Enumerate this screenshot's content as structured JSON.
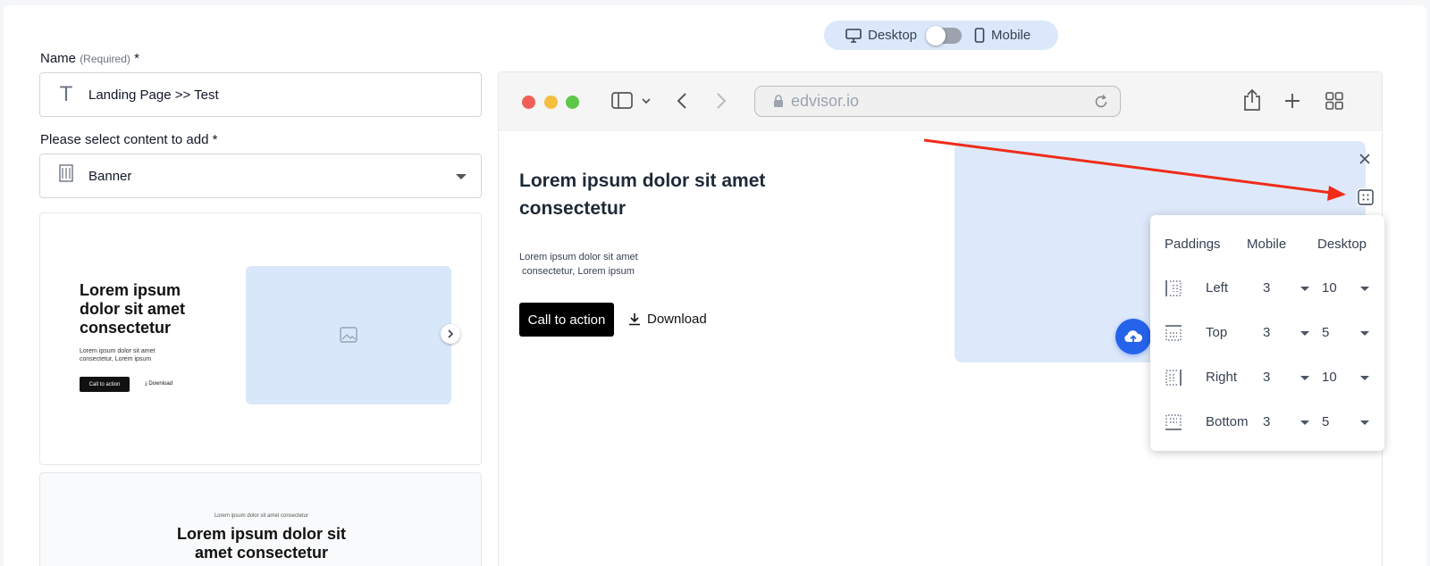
{
  "view_toggle": {
    "desktop_label": "Desktop",
    "mobile_label": "Mobile",
    "selected": "Desktop"
  },
  "form": {
    "name_label": "Name",
    "name_required_hint": "(Required)",
    "asterisk": "*",
    "name_value": "Landing Page >> Test",
    "content_label": "Please select content to add",
    "content_value": "Banner"
  },
  "templates": [
    {
      "title": "Lorem ipsum dolor sit amet consectetur",
      "text": "Lorem ipsum dolor sit amet consectetur, Lorem ipsum",
      "cta": "Call to action",
      "download": "Download"
    },
    {
      "eyebrow": "Lorem ipsum dolor sit amet consectetur",
      "title": "Lorem ipsum dolor sit amet consectetur"
    }
  ],
  "browser": {
    "url": "edvisor.io"
  },
  "preview": {
    "title": "Lorem ipsum dolor sit amet consectetur",
    "text_line1": "Lorem ipsum dolor sit amet",
    "text_line2": "consectetur, Lorem ipsum",
    "cta": "Call to action",
    "download": "Download"
  },
  "paddings": {
    "header": "Paddings",
    "col_mobile": "Mobile",
    "col_desktop": "Desktop",
    "rows": [
      {
        "label": "Left",
        "mobile": "3",
        "desktop": "10"
      },
      {
        "label": "Top",
        "mobile": "3",
        "desktop": "5"
      },
      {
        "label": "Right",
        "mobile": "3",
        "desktop": "10"
      },
      {
        "label": "Bottom",
        "mobile": "3",
        "desktop": "5"
      }
    ]
  },
  "colors": {
    "accent": "#2563eb",
    "arrow": "#ef2b1a",
    "image_placeholder": "#dde9fa"
  }
}
